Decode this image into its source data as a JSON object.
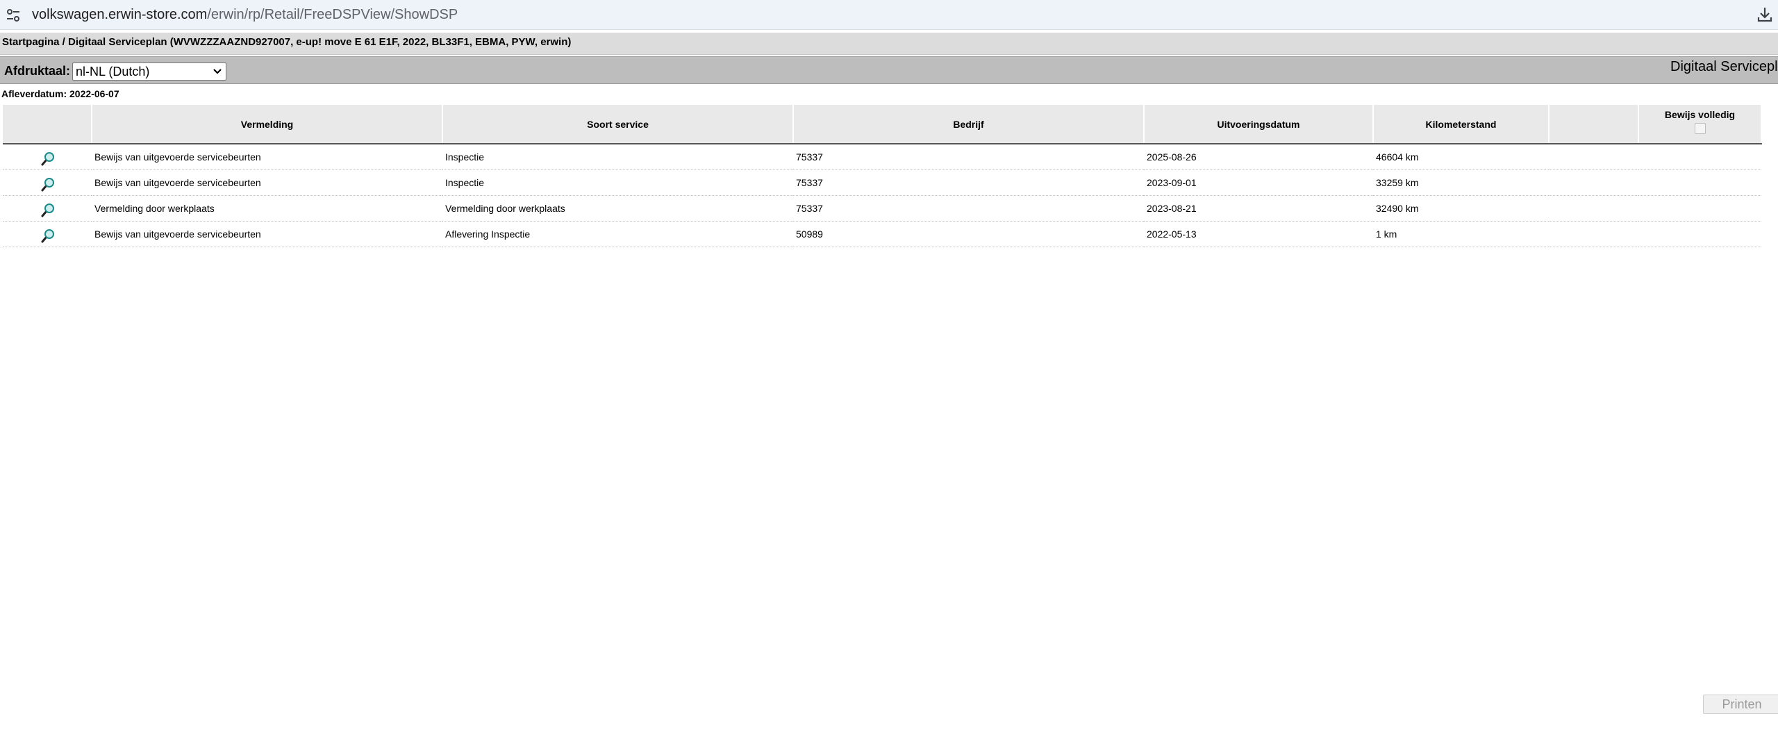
{
  "browser": {
    "url_host": "volkswagen.erwin-store.com",
    "url_path": "/erwin/rp/Retail/FreeDSPView/ShowDSP"
  },
  "breadcrumb": "Startpagina / Digitaal Serviceplan (WVWZZZAAZND927007, e-up! move E 61 E1F, 2022, BL33F1, EBMA, PYW, erwin)",
  "toolbar": {
    "language_label": "Afdruktaal:",
    "language_selected": "nl-NL (Dutch)",
    "title": "Digitaal Serviceplan"
  },
  "delivery_date": "Afleverdatum: 2022-06-07",
  "table": {
    "headers": [
      "",
      "Vermelding",
      "Soort service",
      "Bedrijf",
      "Uitvoeringsdatum",
      "Kilometerstand",
      "",
      "Bewijs volledig"
    ],
    "rows": [
      {
        "vermelding": "Bewijs van uitgevoerde servicebeurten",
        "soort": "Inspectie",
        "bedrijf": "75337",
        "datum": "2025-08-26",
        "km": "46604 km"
      },
      {
        "vermelding": "Bewijs van uitgevoerde servicebeurten",
        "soort": "Inspectie",
        "bedrijf": "75337",
        "datum": "2023-09-01",
        "km": "33259 km"
      },
      {
        "vermelding": "Vermelding door werkplaats",
        "soort": "Vermelding door werkplaats",
        "bedrijf": "75337",
        "datum": "2023-08-21",
        "km": "32490 km"
      },
      {
        "vermelding": "Bewijs van uitgevoerde servicebeurten",
        "soort": "Aflevering Inspectie",
        "bedrijf": "50989",
        "datum": "2022-05-13",
        "km": "1 km"
      }
    ]
  },
  "print_button": "Printen",
  "colors": {
    "address_bar": "#eef2f9",
    "breadcrumb_bg": "#dcdcdc",
    "toolbar_bg": "#bdbdbd",
    "header_bg": "#e9e9e9",
    "zoom_icon_lens": "#1a8a8a"
  }
}
